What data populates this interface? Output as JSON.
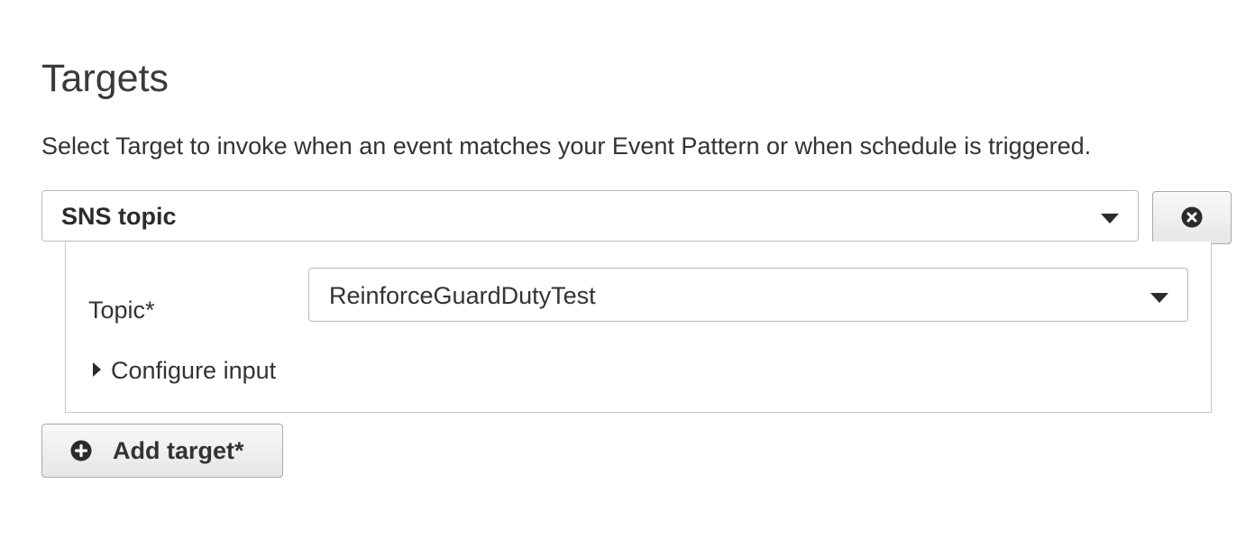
{
  "section": {
    "title": "Targets",
    "description": "Select Target to invoke when an event matches your Event Pattern or when schedule is triggered."
  },
  "target": {
    "type_selected": "SNS topic",
    "remove_icon": "close-circle-icon",
    "topic": {
      "label": "Topic*",
      "selected": "ReinforceGuardDutyTest"
    },
    "configure_input_label": "Configure input"
  },
  "add_target": {
    "label": "Add target*",
    "icon": "plus-circle-icon"
  }
}
